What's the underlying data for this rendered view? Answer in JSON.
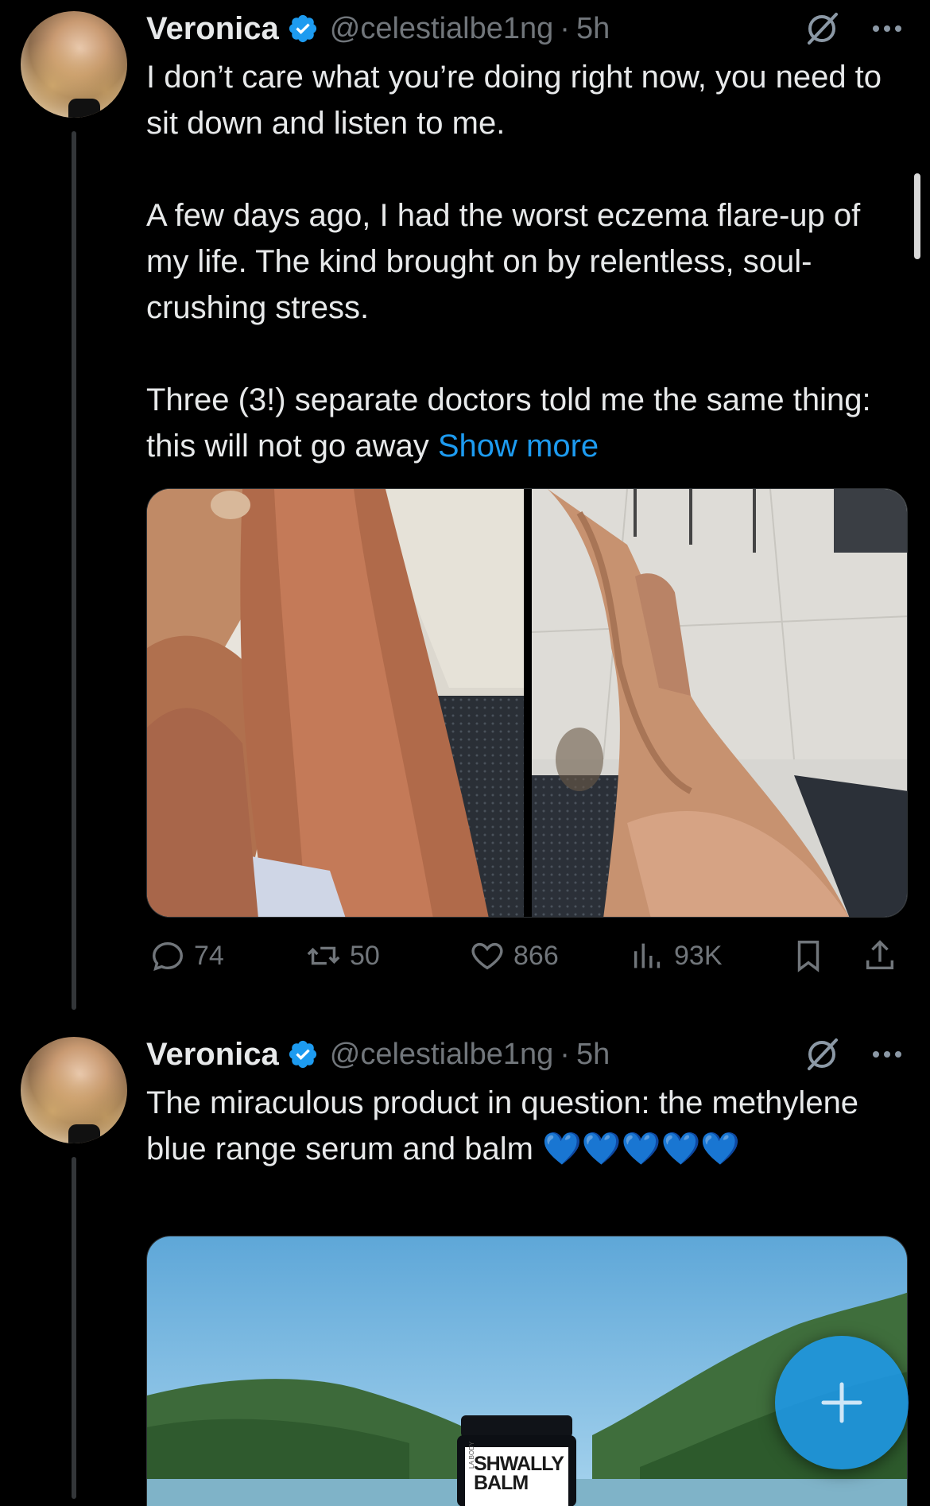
{
  "tweets": [
    {
      "name": "Veronica",
      "handle": "@celestialbe1ng",
      "sep": "·",
      "time": "5h",
      "text": "I don’t care what you’re doing right now, you need to sit down and listen to me.\n\nA few days ago, I had the worst eczema flare-up of my life. The kind brought on by relentless, soul-crushing stress.\n\nThree (3!) separate doctors told me the same thing: this will not go away ",
      "show_more": "Show more",
      "stats": {
        "replies": "74",
        "reposts": "50",
        "likes": "866",
        "views": "93K"
      }
    },
    {
      "name": "Veronica",
      "handle": "@celestialbe1ng",
      "sep": "·",
      "time": "5h",
      "text": "The miraculous product in question: the methylene blue range serum and balm ",
      "hearts": "💙💙💙💙💙",
      "product_label": "SHWALLY",
      "product_label_2": "BALM",
      "product_side_label": "LA BODY"
    }
  ],
  "colors": {
    "accent": "#1d9bf0",
    "muted": "#71767b",
    "background": "#000000",
    "text": "#e7e9ea"
  }
}
